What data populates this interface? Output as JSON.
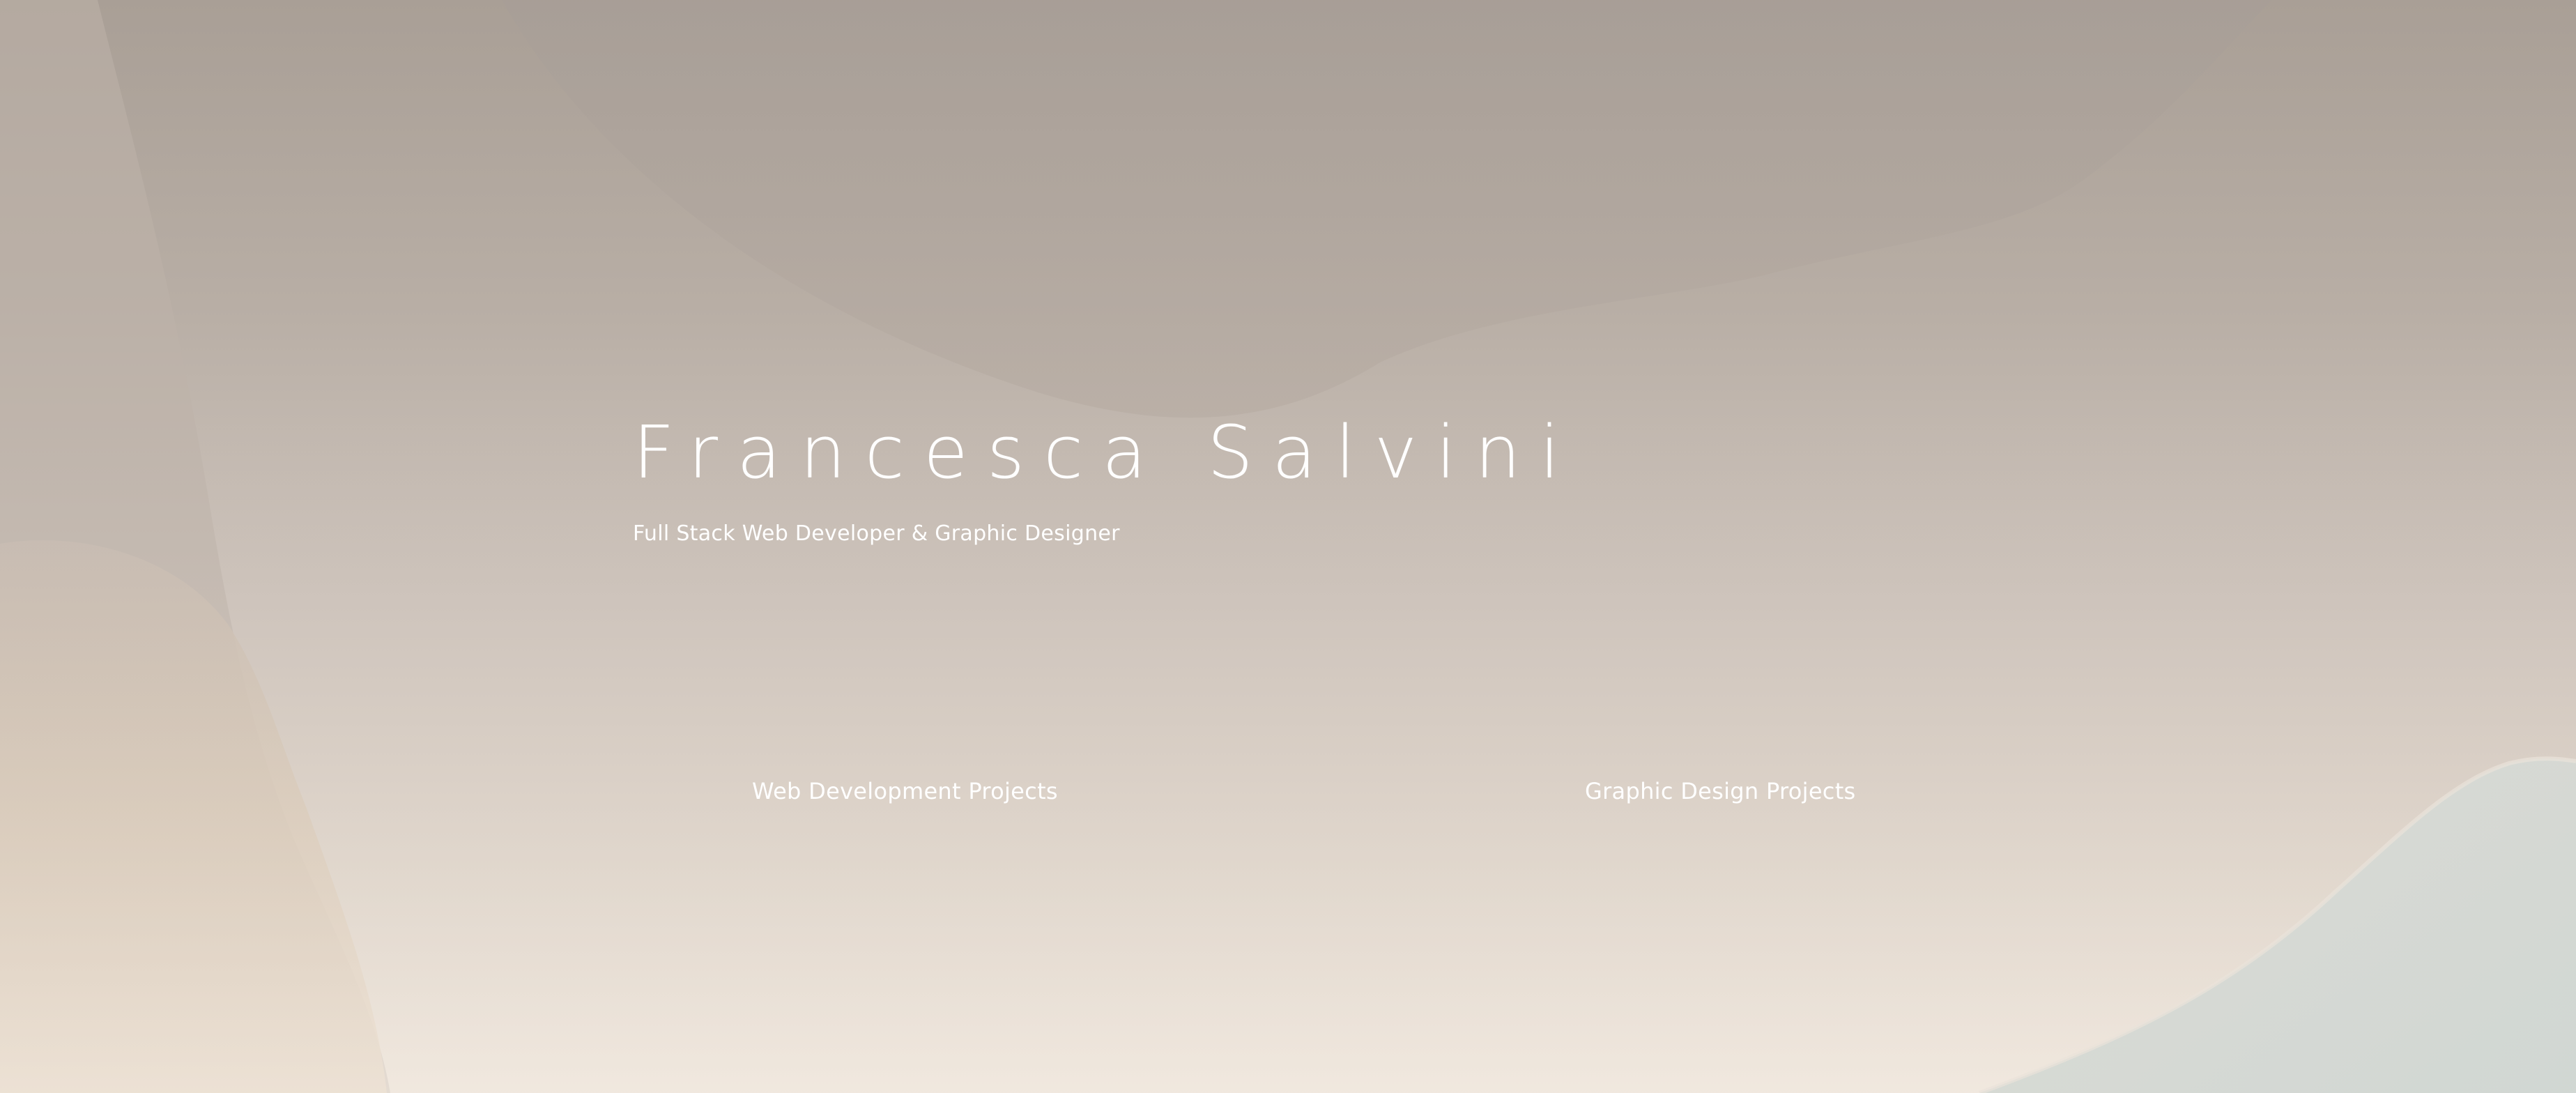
{
  "hero": {
    "name": "Francesca Salvini",
    "tagline": "Full Stack Web Developer & Graphic Designer"
  },
  "projects": {
    "web_label": "Web Development Projects",
    "graphic_label": "Graphic Design Projects"
  },
  "colors": {
    "text": "#ffffff",
    "background_top": "#a99f96",
    "background_bottom": "#efe6dc",
    "accent_warm": "#e6d3bd",
    "accent_cool": "#d0d6d2"
  }
}
